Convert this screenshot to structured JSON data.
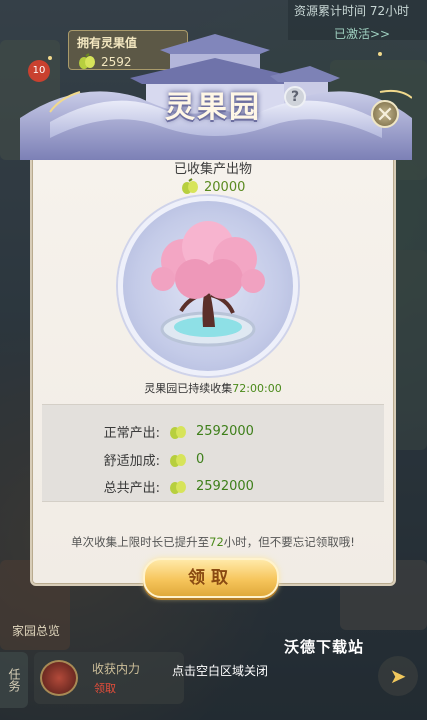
{
  "background": {
    "resource_text": "资源累计时间",
    "resource_time": "72小时",
    "activated_text": "已激活>>",
    "owned_label": "拥有灵果值",
    "owned_value": "2592",
    "badge": "10",
    "home_label": "家园总览",
    "task_label": "任务",
    "task_text": "收获内力",
    "task_sub": "领取",
    "close_hint": "点击空白区域关闭"
  },
  "panel": {
    "title": "灵果园",
    "help": "?",
    "close": "✕",
    "collected_title": "已收集产出物",
    "collected_value": "20000",
    "duration_label": "灵果园已持续收集",
    "duration_time": "72:00:00",
    "stats": [
      {
        "label": "正常产出:",
        "value": "2592000"
      },
      {
        "label": "舒适加成:",
        "value": "0"
      },
      {
        "label": "总共产出:",
        "value": "2592000"
      }
    ],
    "notice_pre": "单次收集上限时长已提升至",
    "notice_hours": "72",
    "notice_post": "小时，但不要忘记领取哦!",
    "claim_button": "领取"
  },
  "watermark": "沃德下载站",
  "colors": {
    "accent_green": "#4b8a1b",
    "button_gold": "#f6c55c",
    "panel_bg": "#f6f2ec"
  }
}
